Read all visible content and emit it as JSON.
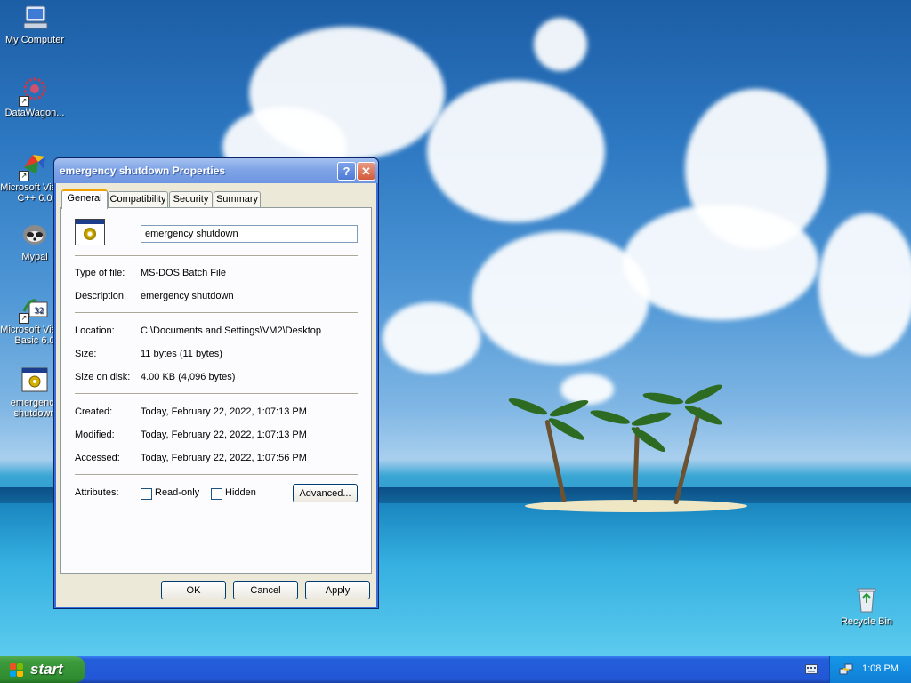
{
  "desktop": {
    "icons": [
      {
        "label": "My Computer",
        "icon": "computer-icon"
      },
      {
        "label": "DataWagon...",
        "icon": "datawagon-icon"
      },
      {
        "label": "Microsoft Visual C++ 6.0",
        "icon": "visual-cpp-icon"
      },
      {
        "label": "Mypal",
        "icon": "mypal-icon"
      },
      {
        "label": "Microsoft Visual Basic 6.0",
        "icon": "visual-basic-icon"
      },
      {
        "label": "emergency shutdown",
        "icon": "batch-file-icon"
      },
      {
        "label": "Recycle Bin",
        "icon": "recycle-bin-icon"
      }
    ]
  },
  "dialog": {
    "title": "emergency shutdown Properties",
    "help_glyph": "?",
    "close_glyph": "✕",
    "tabs": [
      "General",
      "Compatibility",
      "Security",
      "Summary"
    ],
    "active_tab": "General",
    "file_name": "emergency shutdown",
    "fields": {
      "type_label": "Type of file:",
      "type_value": "MS-DOS Batch File",
      "description_label": "Description:",
      "description_value": "emergency shutdown",
      "location_label": "Location:",
      "location_value": "C:\\Documents and Settings\\VM2\\Desktop",
      "size_label": "Size:",
      "size_value": "11 bytes (11 bytes)",
      "size_on_disk_label": "Size on disk:",
      "size_on_disk_value": "4.00 KB (4,096 bytes)",
      "created_label": "Created:",
      "created_value": "Today, February 22, 2022, 1:07:13 PM",
      "modified_label": "Modified:",
      "modified_value": "Today, February 22, 2022, 1:07:13 PM",
      "accessed_label": "Accessed:",
      "accessed_value": "Today, February 22, 2022, 1:07:56 PM",
      "attributes_label": "Attributes:"
    },
    "readonly_label": "Read-only",
    "hidden_label": "Hidden",
    "advanced_button": "Advanced...",
    "ok_button": "OK",
    "cancel_button": "Cancel",
    "apply_button": "Apply"
  },
  "taskbar": {
    "start_label": "start",
    "clock": "1:08 PM"
  },
  "colors": {
    "titlebar": "#7fa4e6",
    "taskbar": "#245edb",
    "start_button": "#3c9a3c",
    "dialog_face": "#ece9d8"
  }
}
